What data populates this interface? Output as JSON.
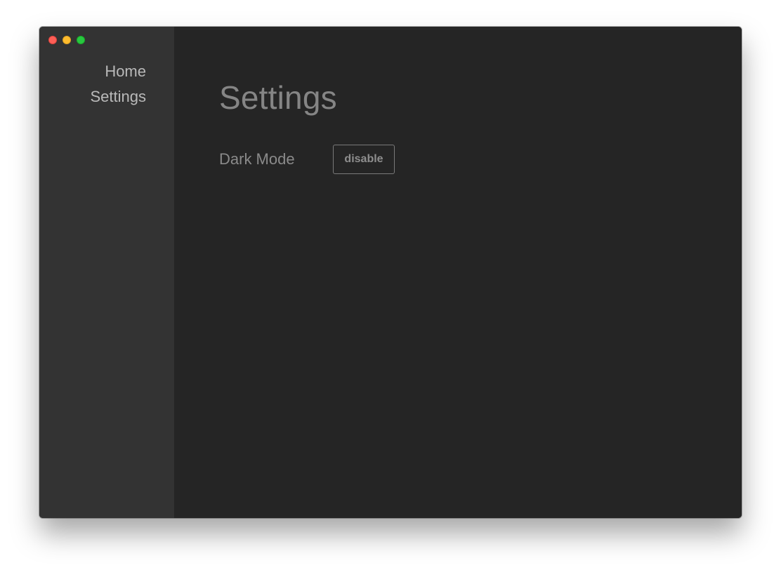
{
  "window": {
    "controls": {
      "close_color": "#fe5f57",
      "minimize_color": "#febc2e",
      "zoom_color": "#28c840"
    }
  },
  "sidebar": {
    "items": [
      {
        "label": "Home"
      },
      {
        "label": "Settings"
      }
    ]
  },
  "main": {
    "title": "Settings",
    "settings": [
      {
        "label": "Dark Mode",
        "button_label": "disable"
      }
    ]
  }
}
